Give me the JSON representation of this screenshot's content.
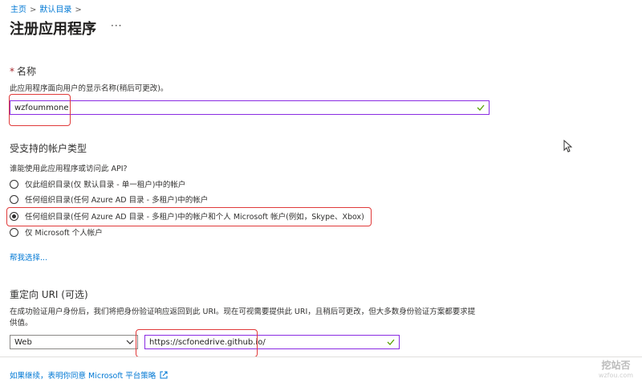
{
  "breadcrumb": {
    "home": "主页",
    "directory": "默认目录",
    "separator": ">"
  },
  "page": {
    "title": "注册应用程序",
    "more": "···"
  },
  "name_section": {
    "required_mark": "*",
    "label": "名称",
    "help": "此应用程序面向用户的显示名称(稍后可更改)。",
    "value": "wzfoummone"
  },
  "account_section": {
    "label": "受支持的帐户类型",
    "question": "谁能使用此应用程序或访问此 API?",
    "options": [
      {
        "label": "仅此组织目录(仅 默认目录 - 单一租户)中的帐户",
        "selected": false
      },
      {
        "label": "任何组织目录(任何 Azure AD 目录 - 多租户)中的帐户",
        "selected": false
      },
      {
        "label": "任何组织目录(任何 Azure AD 目录 - 多租户)中的帐户和个人 Microsoft 帐户(例如，Skype、Xbox)",
        "selected": true
      },
      {
        "label": "仅 Microsoft 个人帐户",
        "selected": false
      }
    ],
    "help_link": "帮我选择..."
  },
  "redirect_section": {
    "label": "重定向 URI (可选)",
    "help_line1": "在成功验证用户身份后，我们将把身份验证响应返回到此 URI。现在可视需要提供此 URI，且稍后可更改，但大多数身份验证方案都要求提",
    "help_line2": "供值。",
    "platform": "Web",
    "uri": "https://scfonedrive.github.io/"
  },
  "footer": {
    "policy_link": "如果继续，表明你同意 Microsoft 平台策略"
  },
  "watermark": {
    "line1": "挖站否",
    "line2": "wzfou.com"
  },
  "icons": {
    "check": "checkmark-icon",
    "chevron": "chevron-down-icon",
    "external": "external-link-icon",
    "cursor": "mouse-pointer-icon"
  },
  "colors": {
    "accent": "#0078d4",
    "valid_border": "#8a2be2",
    "check": "#57a300",
    "highlight": "#e03a3a"
  }
}
